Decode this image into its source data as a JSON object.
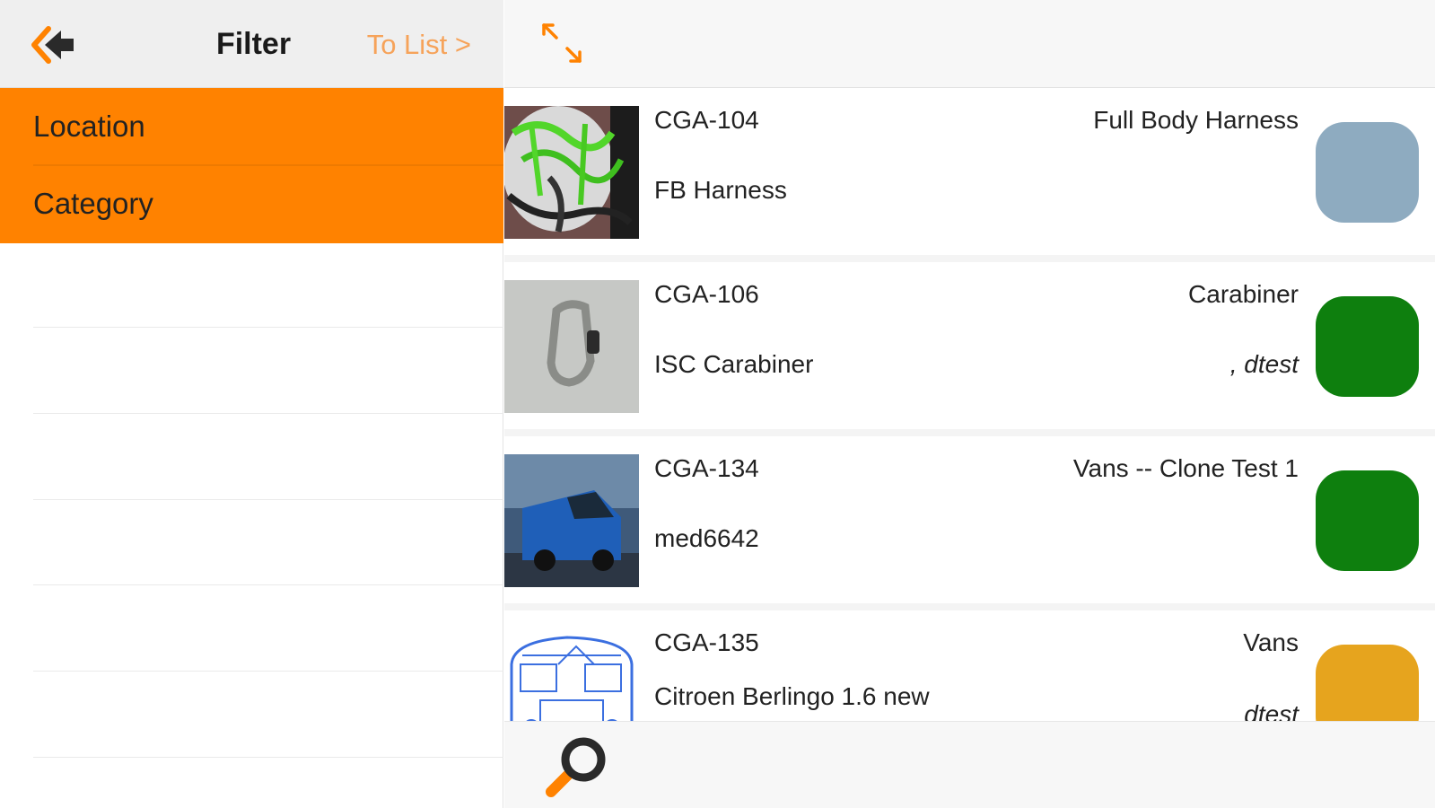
{
  "header": {
    "back_icon": "back-chevron-icon",
    "title": "Filter",
    "to_list": "To List >",
    "expand_icon": "expand-arrows-icon"
  },
  "filters": [
    {
      "label": "Location"
    },
    {
      "label": "Category"
    }
  ],
  "items": [
    {
      "code": "CGA-104",
      "category": "Full Body Harness",
      "name": "FB Harness",
      "user": "",
      "status_color": "#8eabc0",
      "thumb": "harness-photo"
    },
    {
      "code": "CGA-106",
      "category": "Carabiner",
      "name": "ISC Carabiner",
      "user": ", dtest",
      "status_color": "#0e7f0e",
      "thumb": "carabiner-photo"
    },
    {
      "code": "CGA-134",
      "category": "Vans -- Clone Test 1",
      "name": "med6642",
      "user": "",
      "status_color": "#0e7f0e",
      "thumb": "blue-van-photo"
    },
    {
      "code": "CGA-135",
      "category": "Vans",
      "name": "Citroen Berlingo 1.6 new",
      "user": "dtest",
      "status_color": "#e6a41e",
      "thumb": "van-blueprint-drawing"
    }
  ],
  "bottom": {
    "search_icon": "search-icon"
  },
  "colors": {
    "accent": "#ff8200",
    "to_list": "#f6a35a"
  }
}
